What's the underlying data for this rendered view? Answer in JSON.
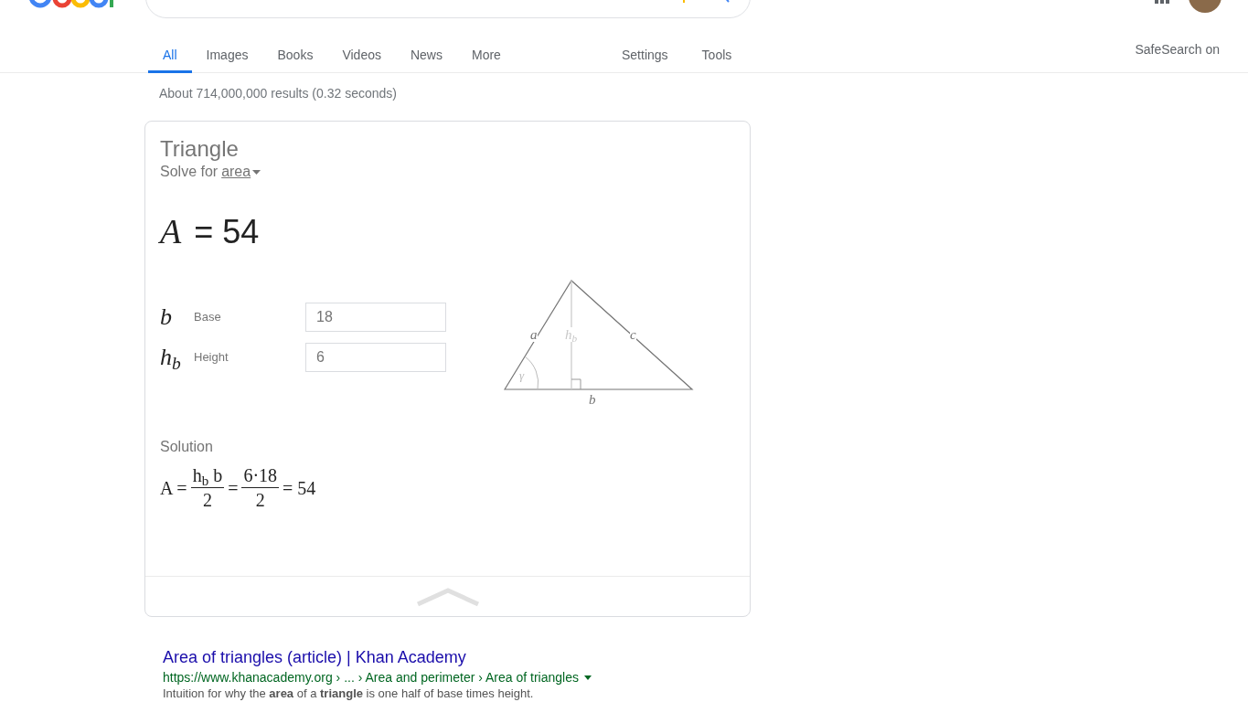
{
  "tabs": [
    {
      "label": "All",
      "selected": true
    },
    {
      "label": "Images",
      "selected": false
    },
    {
      "label": "Books",
      "selected": false
    },
    {
      "label": "Videos",
      "selected": false
    },
    {
      "label": "News",
      "selected": false
    },
    {
      "label": "More",
      "selected": false
    }
  ],
  "tools": [
    "Settings",
    "Tools"
  ],
  "safesearch": "SafeSearch on",
  "result_stats": "About 714,000,000 results (0.32 seconds)",
  "calculator": {
    "title": "Triangle",
    "solve_prefix": "Solve for",
    "solve_target": "area",
    "result_symbol": "A",
    "result_value": "= 54",
    "inputs": [
      {
        "symbol": "b",
        "label": "Base",
        "value": "18"
      },
      {
        "symbol": "h$_{b}$",
        "label": "Height",
        "value": "6"
      }
    ],
    "diagram_labels": {
      "side_a": "a",
      "height": "h$_{b}$",
      "side_c": "c",
      "angle": "γ",
      "base": "b"
    },
    "solution_heading": "Solution",
    "formula": [
      {
        "kind": "text",
        "text": "A ="
      },
      {
        "kind": "fraction",
        "numerator": "h$_{b}$ b",
        "denominator": "2"
      },
      {
        "kind": "text",
        "text": "="
      },
      {
        "kind": "fraction",
        "numerator": "6·18",
        "denominator": "2"
      },
      {
        "kind": "text",
        "text": "= 54"
      }
    ]
  },
  "result": {
    "title": "Area of triangles (article) | Khan Academy",
    "url": "https://www.khanacademy.org › ... › Area and perimeter › Area of triangles",
    "snippet": "Intuition for why the **area** of a **triangle** is one half of base times height."
  }
}
